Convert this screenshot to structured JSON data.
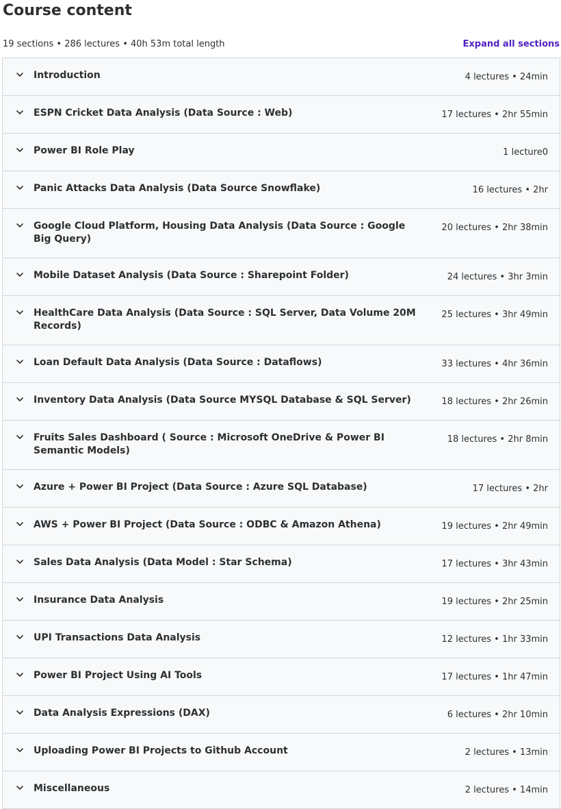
{
  "header": {
    "title": "Course content",
    "summary": "19 sections • 286 lectures • 40h 53m total length",
    "expand_label": "Expand all sections"
  },
  "sections": [
    {
      "title": "Introduction",
      "meta": "4 lectures • 24min"
    },
    {
      "title": "ESPN Cricket Data Analysis (Data Source : Web)",
      "meta": "17 lectures • 2hr 55min"
    },
    {
      "title": "Power BI Role Play",
      "meta": "1 lecture0"
    },
    {
      "title": "Panic Attacks Data Analysis (Data Source Snowflake)",
      "meta": "16 lectures • 2hr"
    },
    {
      "title": "Google Cloud Platform, Housing Data Analysis (Data Source : Google Big Query)",
      "meta": "20 lectures • 2hr 38min"
    },
    {
      "title": "Mobile Dataset Analysis (Data Source : Sharepoint Folder)",
      "meta": "24 lectures • 3hr 3min"
    },
    {
      "title": "HealthCare Data Analysis (Data Source : SQL Server, Data Volume 20M Records)",
      "meta": "25 lectures • 3hr 49min"
    },
    {
      "title": "Loan Default Data Analysis (Data Source : Dataflows)",
      "meta": "33 lectures • 4hr 36min"
    },
    {
      "title": "Inventory Data Analysis (Data Source MYSQL Database & SQL Server)",
      "meta": "18 lectures • 2hr 26min"
    },
    {
      "title": "Fruits Sales Dashboard ( Source : Microsoft OneDrive & Power BI Semantic Models)",
      "meta": "18 lectures • 2hr 8min"
    },
    {
      "title": "Azure + Power BI Project (Data Source : Azure SQL Database)",
      "meta": "17 lectures • 2hr"
    },
    {
      "title": "AWS + Power BI Project (Data Source : ODBC & Amazon Athena)",
      "meta": "19 lectures • 2hr 49min"
    },
    {
      "title": "Sales Data Analysis (Data Model : Star Schema)",
      "meta": "17 lectures • 3hr 43min"
    },
    {
      "title": "Insurance Data Analysis",
      "meta": "19 lectures • 2hr 25min"
    },
    {
      "title": "UPI Transactions Data Analysis",
      "meta": "12 lectures • 1hr 33min"
    },
    {
      "title": "Power BI Project Using AI Tools",
      "meta": "17 lectures • 1hr 47min"
    },
    {
      "title": "Data Analysis Expressions (DAX)",
      "meta": "6 lectures • 2hr 10min"
    },
    {
      "title": "Uploading Power BI Projects to Github Account",
      "meta": "2 lectures • 13min"
    },
    {
      "title": "Miscellaneous",
      "meta": "2 lectures • 14min"
    }
  ]
}
